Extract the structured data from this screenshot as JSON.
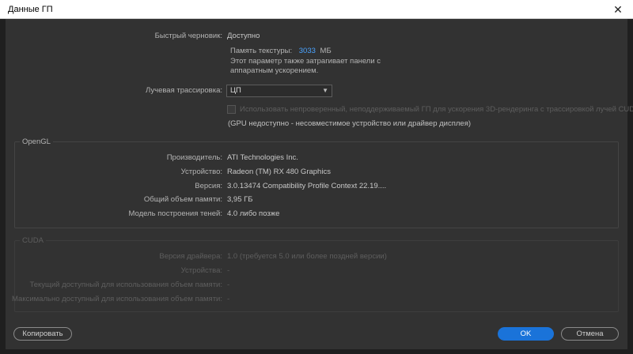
{
  "window": {
    "title": "Данные ГП",
    "close_glyph": "✕"
  },
  "renderer": {
    "fast_draft_label": "Быстрый черновик:",
    "fast_draft_value": "Доступно",
    "texture_memory_label": "Память текстуры:",
    "texture_memory_value": "3033",
    "texture_memory_unit": "МБ",
    "texture_note_line1": "Этот параметр также затрагивает панели с",
    "texture_note_line2": "аппаратным ускорением.",
    "ray_tracing_label": "Лучевая трассировка:",
    "ray_tracing_value": "ЦП",
    "unsupported_gpu_checkbox_label": "Использовать непроверенный, неподдерживаемый ГП для ускорения 3D-рендеринга с трассировкой лучей CUDA",
    "gpu_unavailable_note": "(GPU недоступно - несовместимое устройство или драйвер дисплея)"
  },
  "opengl": {
    "legend": "OpenGL",
    "rows": [
      {
        "label": "Производитель:",
        "value": "ATI Technologies Inc."
      },
      {
        "label": "Устройство:",
        "value": "Radeon (TM) RX 480 Graphics"
      },
      {
        "label": "Версия:",
        "value": "3.0.13474 Compatibility Profile Context 22.19...."
      },
      {
        "label": "Общий объем памяти:",
        "value": "3,95 ГБ"
      },
      {
        "label": "Модель построения теней:",
        "value": "4.0 либо позже"
      }
    ]
  },
  "cuda": {
    "legend": "CUDA",
    "rows": [
      {
        "label": "Версия драйвера:",
        "value": "1.0 (требуется 5.0 или более поздней версии)"
      },
      {
        "label": "Устройства:",
        "value": "-"
      },
      {
        "label": "Текущий доступный для использования объем памяти:",
        "value": "-"
      },
      {
        "label": "Максимально доступный для использования объем памяти:",
        "value": "-"
      }
    ]
  },
  "buttons": {
    "copy": "Копировать",
    "ok": "OK",
    "cancel": "Отмена"
  },
  "colors": {
    "accent": "#1a73d9",
    "texture_value": "#4aa3ff",
    "dialog_bg": "#323232"
  }
}
